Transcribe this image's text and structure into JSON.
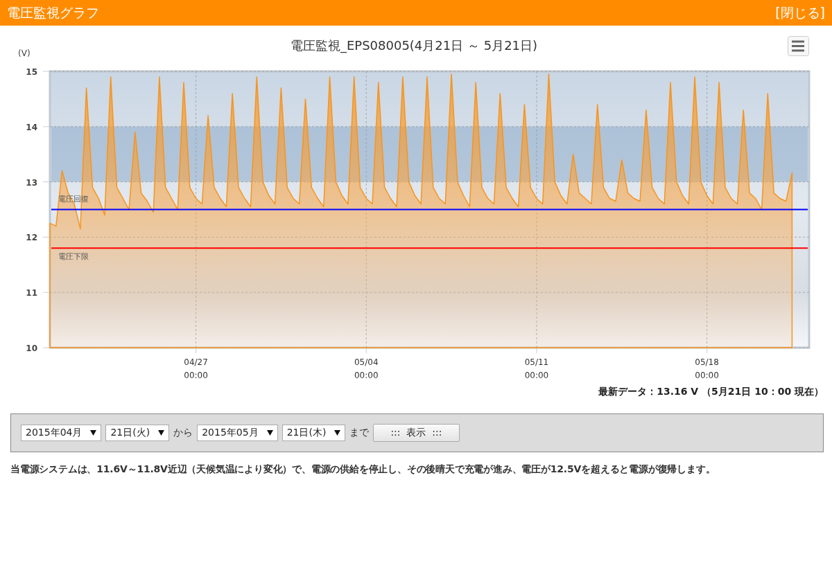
{
  "header": {
    "title": "電圧監視グラフ",
    "close_link": "[閉じる]"
  },
  "chart": {
    "chart_data": {
      "type": "area",
      "title": "電圧監視_EPS08005(4月21日 ～ 5月21日)",
      "ylabel": "(V)",
      "grid": true,
      "ylim": [
        10,
        15
      ],
      "yticks": [
        10,
        11,
        12,
        13,
        14,
        15
      ],
      "categories": [
        null,
        null,
        null,
        null,
        null,
        null,
        null,
        null,
        null,
        null,
        null,
        null,
        null,
        null,
        null,
        null,
        null,
        null,
        null,
        null,
        null,
        null,
        null,
        null,
        "04/27 00:00",
        null,
        null,
        null,
        null,
        null,
        null,
        null,
        null,
        null,
        null,
        null,
        null,
        null,
        null,
        null,
        null,
        null,
        null,
        null,
        null,
        null,
        null,
        null,
        null,
        null,
        null,
        null,
        "05/04 00:00",
        null,
        null,
        null,
        null,
        null,
        null,
        null,
        null,
        null,
        null,
        null,
        null,
        null,
        null,
        null,
        null,
        null,
        null,
        null,
        null,
        null,
        null,
        null,
        null,
        null,
        null,
        null,
        "05/11 00:00",
        null,
        null,
        null,
        null,
        null,
        null,
        null,
        null,
        null,
        null,
        null,
        null,
        null,
        null,
        null,
        null,
        null,
        null,
        null,
        null,
        null,
        null,
        null,
        null,
        null,
        null,
        null,
        "05/18 00:00",
        null,
        null,
        null,
        null,
        null,
        null,
        null,
        null,
        null,
        null,
        null,
        null,
        null,
        null
      ],
      "series": [
        {
          "color": "#f7941d",
          "values": [
            12.25,
            12.2,
            13.2,
            12.8,
            12.6,
            12.15,
            14.7,
            12.9,
            12.7,
            12.4,
            14.9,
            12.9,
            12.7,
            12.5,
            13.9,
            12.8,
            12.65,
            12.45,
            14.9,
            12.9,
            12.7,
            12.5,
            14.8,
            12.9,
            12.7,
            12.6,
            14.2,
            12.9,
            12.7,
            12.55,
            14.6,
            12.9,
            12.7,
            12.55,
            14.9,
            13.0,
            12.75,
            12.6,
            14.7,
            12.9,
            12.7,
            12.6,
            14.5,
            12.9,
            12.7,
            12.55,
            14.9,
            13.0,
            12.75,
            12.6,
            14.9,
            12.9,
            12.7,
            12.6,
            14.8,
            12.9,
            12.7,
            12.55,
            14.9,
            13.0,
            12.75,
            12.6,
            14.9,
            12.9,
            12.7,
            12.6,
            14.95,
            13.0,
            12.75,
            12.55,
            14.8,
            12.9,
            12.7,
            12.6,
            14.6,
            12.9,
            12.7,
            12.55,
            14.4,
            12.9,
            12.7,
            12.6,
            14.95,
            13.0,
            12.75,
            12.6,
            13.5,
            12.8,
            12.7,
            12.6,
            14.4,
            12.9,
            12.7,
            12.65,
            13.4,
            12.8,
            12.7,
            12.65,
            14.3,
            12.9,
            12.7,
            12.6,
            14.8,
            13.0,
            12.75,
            12.6,
            14.9,
            13.0,
            12.75,
            12.6,
            14.8,
            12.9,
            12.7,
            12.6,
            14.3,
            12.8,
            12.7,
            12.5,
            14.6,
            12.8,
            12.7,
            12.65,
            13.16
          ]
        }
      ],
      "bands": [
        {
          "axis": "y",
          "from": 13,
          "to": 14
        }
      ],
      "ref_lines": [
        {
          "axis": "y",
          "value": 12.5,
          "label": "電圧回復",
          "color": "#0000ff"
        },
        {
          "axis": "y",
          "value": 11.8,
          "label": "電圧下限",
          "color": "#ff0000"
        }
      ]
    },
    "latest": "最新データ：13.16 V （5月21日 10：00 現在）"
  },
  "form": {
    "controls": [
      {
        "kind": "select",
        "value": "2015年04月"
      },
      {
        "kind": "select",
        "value": "21日(火)"
      },
      {
        "kind": "text",
        "value": "から"
      },
      {
        "kind": "select",
        "value": "2015年05月"
      },
      {
        "kind": "select",
        "value": "21日(木)"
      },
      {
        "kind": "text",
        "value": "まで"
      },
      {
        "kind": "button",
        "value": ":::  表示  :::"
      }
    ]
  },
  "note": "当電源システムは、11.6V～11.8V近辺（天候気温により変化）で、電源の供給を停止し、その後晴天で充電が進み、電圧が12.5Vを超えると電源が復帰します。"
}
